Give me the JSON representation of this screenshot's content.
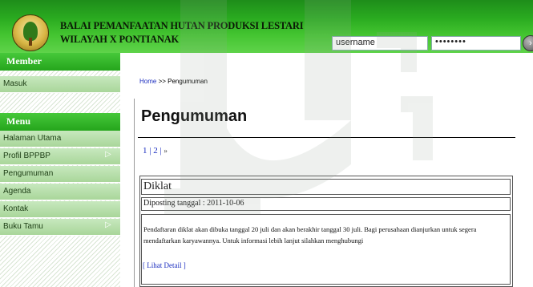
{
  "header": {
    "title_line1": "BALAI PEMANFAATAN HUTAN PRODUKSI LESTARI",
    "title_line2": "WILAYAH X PONTIANAK",
    "username_value": "username",
    "password_value": "••••••••",
    "go_icon": "chevron-right-icon"
  },
  "sidebar": {
    "member_heading": "Member",
    "member_items": [
      {
        "label": "Masuk"
      }
    ],
    "menu_heading": "Menu",
    "menu_items": [
      {
        "label": "Halaman Utama",
        "has_submenu": false
      },
      {
        "label": "Profil BPPBP",
        "has_submenu": true
      },
      {
        "label": "Pengumuman",
        "has_submenu": false
      },
      {
        "label": "Agenda",
        "has_submenu": false
      },
      {
        "label": "Kontak",
        "has_submenu": false
      },
      {
        "label": "Buku Tamu",
        "has_submenu": true
      }
    ],
    "submenu_arrow": "▷"
  },
  "main": {
    "breadcrumb_home": "Home",
    "breadcrumb_rest": " >> Pengumuman",
    "page_title": "Pengumuman",
    "pager": {
      "page1": "1",
      "sep1": " | ",
      "page2": "2",
      "sep2": " | ",
      "next": "»"
    },
    "post": {
      "title": "Diklat",
      "date": "Diposting tanggal : 2011-10-06",
      "body": "Pendaftaran diklat akan dibuka tanggal 20 juli dan akan berakhir tanggal 30 juli. Bagi perusahaan dianjurkan untuk segera mendaftarkan karyawannya. Untuk informasi lebih lanjut silahkan menghubungi",
      "detail_link": "[ Lihat Detail ]"
    }
  },
  "colors": {
    "header_green": "#2aab20",
    "sidebar_heading_green": "#25a51c",
    "sidebar_item_green": "#b9dfad",
    "link_blue": "#1a2dbf"
  }
}
